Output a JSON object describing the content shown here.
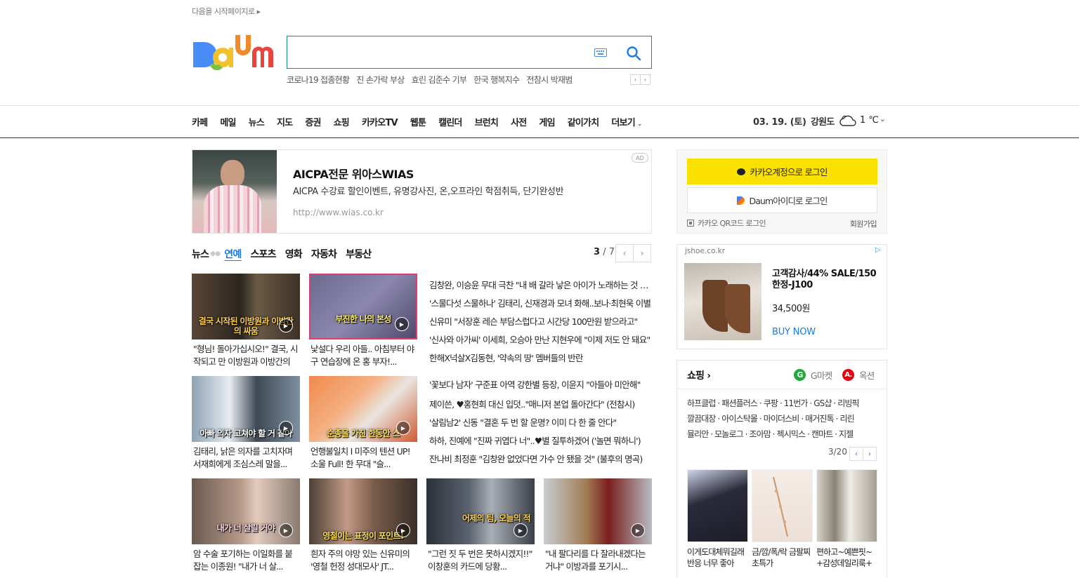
{
  "header": {
    "start_page": "다음을 시작페이지로",
    "logo_text": "Daum",
    "search": {
      "value": "",
      "placeholder": ""
    },
    "trending": [
      "코로나19 접종현황",
      "진 손가락 부상",
      "효린 김준수 기부",
      "한국 행복지수",
      "전참시 박재범"
    ]
  },
  "gnb": {
    "items": [
      "카페",
      "메일",
      "뉴스",
      "지도",
      "증권",
      "쇼핑",
      "카카오TV",
      "웹툰",
      "캘린더",
      "브런치",
      "사전",
      "게임",
      "같이가치"
    ],
    "more": "더보기",
    "date": "03. 19. (토)",
    "region": "강원도",
    "temp": "1 ℃"
  },
  "ad_banner": {
    "title": "AICPA전문 위아스WIAS",
    "desc": "AICPA 수강료 할인이벤트, 유명강사진, 온,오프라인 학점취득, 단기완성반",
    "url": "http://www.wias.co.kr",
    "badge": "AD"
  },
  "news": {
    "tabs": [
      "뉴스",
      "연예",
      "스포츠",
      "영화",
      "자동차",
      "부동산"
    ],
    "active_tab": "연예",
    "page_current": "3",
    "page_total": "/ 7",
    "cards": [
      {
        "caption": "결국 시작된 이방원과 이방간의 싸움",
        "text": "\"형님! 돌아가십시오!\" 결국, 시작되고 만 이방원과 이방간의 싸움"
      },
      {
        "caption": "부진한 나의 본성",
        "text": "낯설다 우리 아들.. 아침부터 야구 연습장에 온 홍 부자!..."
      },
      {
        "caption": "아빠 의자 고쳐야 할 거 같아",
        "text": "김태리, 낡은 의자를 고치자며 서재희에게 조심스레 말을..."
      },
      {
        "caption": "순종을 가진 한동안 스",
        "text": "언행불일치 I 미주의 텐션 UP! 소울 Full! 한 무대 \"슬..."
      },
      {
        "caption": "내가 너 살릴 거야",
        "text": "암 수술 포기하는 이일화를 붙잡는 이종원! \"내가 너 살..."
      },
      {
        "caption": "영철이는 표정이 포인트!",
        "text": "흰자 주의 야망 있는 신유미의 '영철 헌정 성대모사' JT..."
      },
      {
        "caption": "어제의 팀, 오늘의 적",
        "text": "\"그런 짓 두 번은 못하시겠지!!\" 이창훈의 카드에 당황..."
      },
      {
        "caption": "",
        "text": "\"내 팔다리를 다 잘라내겠다는 거냐\" 이방과를 포기시..."
      }
    ],
    "headlines": [
      "김창완, 이승윤 무대 극찬 \"내 배 갈라 낳은 아이가 노래하는 것 같아\"",
      "'스물다섯 스물하나' 김태리, 신재경과 모녀 화해..보나·최현욱 이별",
      "신유미 \"서장훈 레슨 부담스럽다고 시간당 100만원 받으라고\"",
      "'신사와 아가씨' 이세희, 오승아 만난 지현우에 \"이제 저도 안 돼요\"",
      "한해X넉살X김동현, '약속의 땅' 멤버들의 반란",
      "'꽃보다 남자' 구준표 아역 강한별 등장, 이윤지 \"아들아 미안해\"",
      "제이쓴, ♥홍현희 대신 입덧..\"매니저 본업 돌아간다\" (전참시)",
      "'살림남2' 신동 \"결혼 두 번 할 운명? 이미 다 한 줄 안다\"",
      "하하, 진예에 \"진짜 귀엽다 너\"..♥별 질투하겠어 ('놀면 뭐하니')",
      "잔나비 최정훈 \"김창완 없었다면 가수 안 됐을 것\" (불후의 명곡)"
    ]
  },
  "login": {
    "kakao": "카카오계정으로 로그인",
    "daum": "Daum아이디로 로그인",
    "qr": "카카오 QR코드 로그인",
    "signup": "회원가입"
  },
  "ad_side": {
    "source": "jshoe.co.kr",
    "title": "고객감사/44% SALE/150 한정-J100",
    "price": "34,500원",
    "cta": "BUY NOW"
  },
  "shopping": {
    "title": "쇼핑",
    "gmarket": "G마켓",
    "auction": "옥션",
    "links": [
      "하프클럽 · 패션플러스 · 쿠팡 · 11번가 · GS샵 · 리빙픽",
      "깔끔대장 · 아이스탁몰 · 마이더스비 · 매거진톡 · 리린",
      "뮬리안 · 모놀로그 · 조아맘 · 젝시믹스 · 캔마트 · 지젤"
    ],
    "page": "3/20",
    "products": [
      {
        "title": "이게도대체뭐길래 반응 너무 좋아"
      },
      {
        "title": "금/깜/폭/락 금팔찌 초특가"
      },
      {
        "title": "편하고~예쁜핏~ +감성데일리룩+"
      }
    ]
  },
  "colors": {
    "accent": "#138a94",
    "kakao": "#fae100",
    "link_blue": "#1a7ce8"
  }
}
